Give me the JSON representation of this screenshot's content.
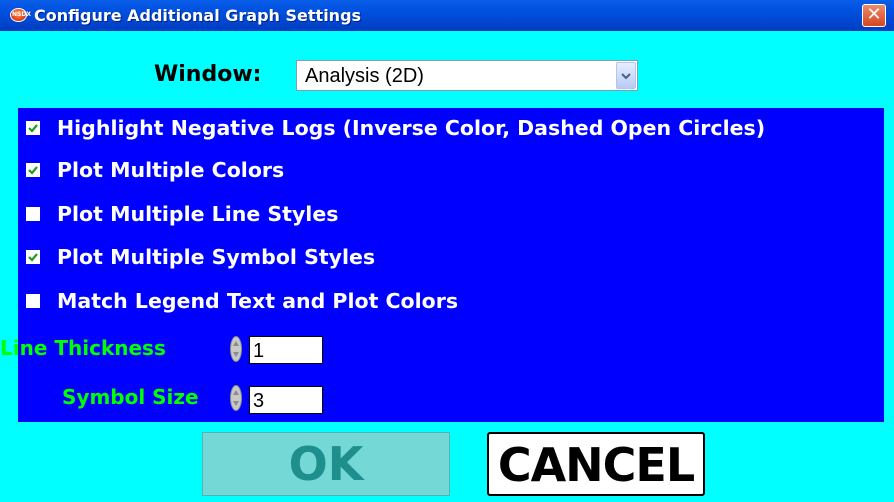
{
  "window": {
    "title": "Configure Additional Graph Settings",
    "app_icon_text": "NSDX",
    "close_label": "✕"
  },
  "window_selector": {
    "label": "Window:",
    "value": "Analysis (2D)"
  },
  "options": [
    {
      "label": "Highlight Negative Logs (Inverse Color, Dashed Open Circles)",
      "checked": true
    },
    {
      "label": "Plot Multiple Colors",
      "checked": true
    },
    {
      "label": "Plot Multiple Line Styles",
      "checked": false
    },
    {
      "label": "Plot Multiple Symbol Styles",
      "checked": true
    },
    {
      "label": "Match Legend Text  and Plot Colors",
      "checked": false
    }
  ],
  "line_thickness": {
    "label": "Line Thickness",
    "value": "1"
  },
  "symbol_size": {
    "label": "Symbol Size",
    "value": "3"
  },
  "buttons": {
    "ok": "OK",
    "cancel": "CANCEL"
  },
  "colors": {
    "background": "#00ffff",
    "panel": "#0000ff",
    "option_text": "#ffffff",
    "numeric_label": "#00ff00",
    "ok_button": "#73d8d6",
    "title_bar": "#0052e0"
  }
}
